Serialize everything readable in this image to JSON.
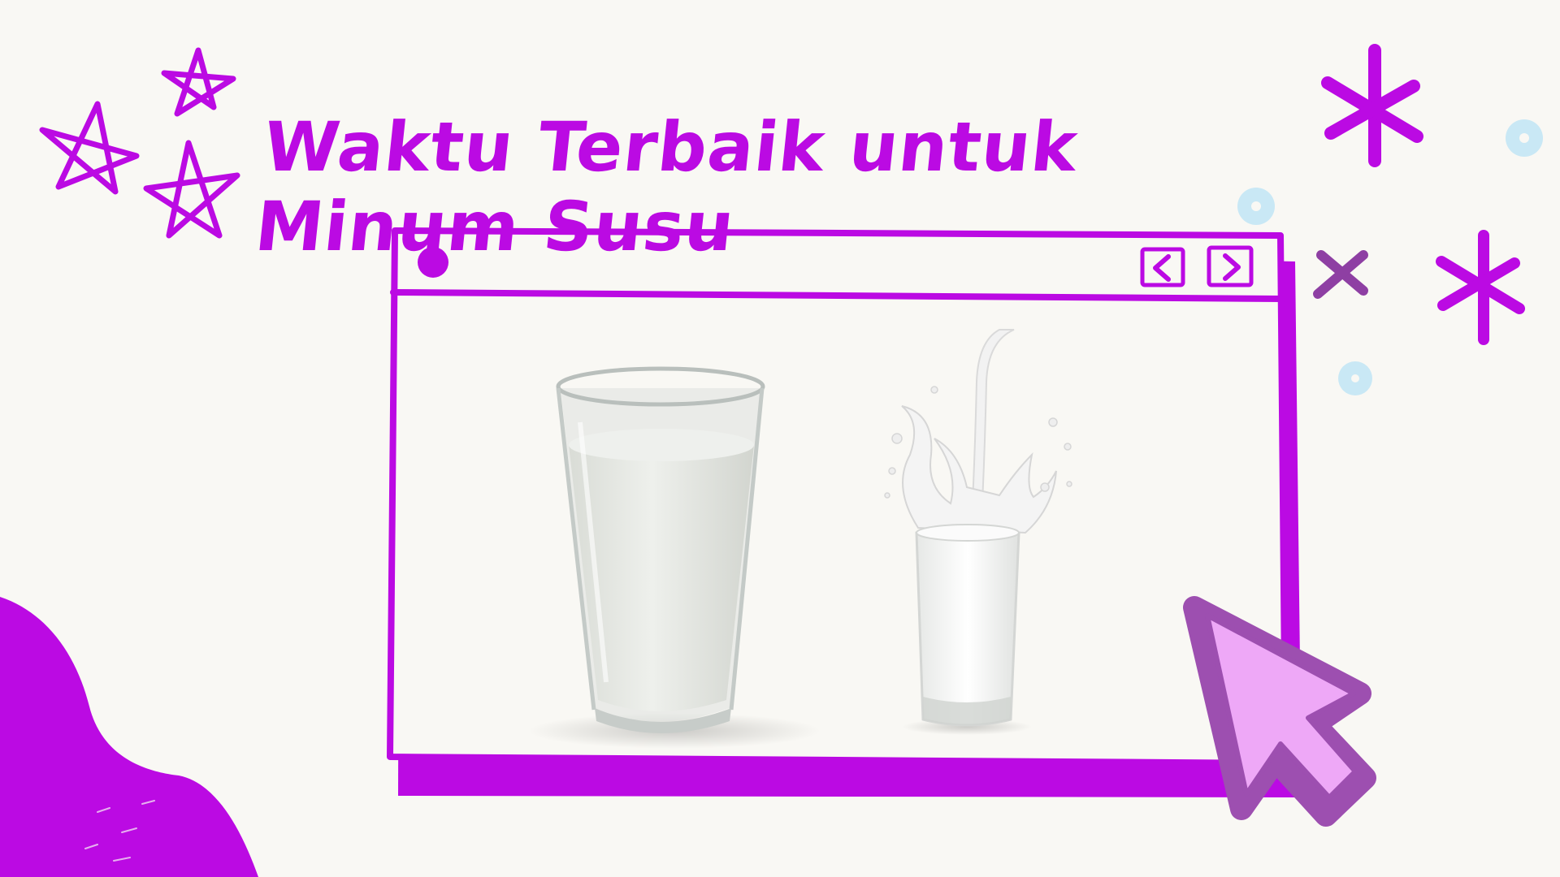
{
  "title": "Waktu Terbaik untuk Minum Susu",
  "colors": {
    "primary": "#bb0ae3",
    "cursor_fill": "#eea8f7",
    "cursor_outline": "#9d4fb0",
    "dot_blue": "#c9e8f5",
    "cross": "#8e3fa3",
    "background": "#f9f8f4"
  },
  "window": {
    "buttons": [
      "prev-arrow",
      "next-arrow"
    ],
    "images": [
      "tall-milk-glass",
      "milk-pour-splash-glass"
    ]
  },
  "icons": [
    "star-icon",
    "asterisk-icon",
    "circle-dot-icon",
    "cross-icon",
    "cursor-arrow-icon"
  ]
}
